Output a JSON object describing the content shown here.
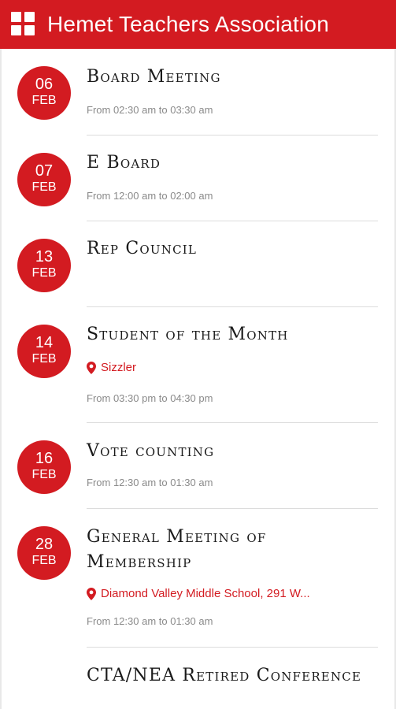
{
  "header": {
    "title": "Hemet Teachers Association"
  },
  "events": [
    {
      "day": "06",
      "month": "FEB",
      "title": "Board Meeting",
      "location": "",
      "time": "From 02:30 am to 03:30 am"
    },
    {
      "day": "07",
      "month": "FEB",
      "title": "E Board",
      "location": "",
      "time": "From 12:00 am to 02:00 am"
    },
    {
      "day": "13",
      "month": "FEB",
      "title": "Rep Council",
      "location": "",
      "time": ""
    },
    {
      "day": "14",
      "month": "FEB",
      "title": "Student of the Month",
      "location": "Sizzler",
      "time": "From 03:30 pm to 04:30 pm"
    },
    {
      "day": "16",
      "month": "FEB",
      "title": "Vote counting",
      "location": "",
      "time": "From 12:30 am to 01:30 am"
    },
    {
      "day": "28",
      "month": "FEB",
      "title": "General Meeting of Membership",
      "location": "Diamond Valley Middle School, 291 W...",
      "time": "From 12:30 am to 01:30 am"
    },
    {
      "day": "",
      "month": "",
      "title": "CTA/NEA Retired Conference",
      "location": "",
      "time": ""
    }
  ],
  "colors": {
    "brand": "#d31b21",
    "time_text": "#8a8a8a",
    "divider": "#dcdcdc"
  },
  "icons": {
    "menu": "grid-icon",
    "location": "pin-icon"
  }
}
